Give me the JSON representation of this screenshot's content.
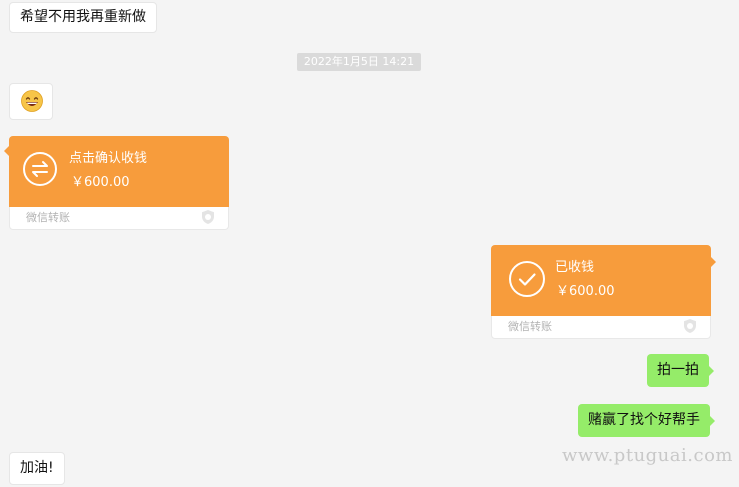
{
  "chat": {
    "messages": {
      "top_text": "希望不用我再重新做",
      "timestamp": "2022年1月5日 14:21",
      "emoji_name": "grinning-face-emoji",
      "transfer_received": {
        "status": "点击确认收钱",
        "amount": "￥600.00",
        "footer": "微信转账"
      },
      "transfer_sent": {
        "status": "已收钱",
        "amount": "￥600.00",
        "footer": "微信转账"
      },
      "reply_pat": "拍一拍",
      "reply_text": "赌赢了找个好帮手",
      "bottom_text": "加油!"
    }
  },
  "watermark": "www.ptuguai.com",
  "colors": {
    "transfer_orange": "#f79c3c",
    "own_bubble_green": "#95ec69",
    "background": "#f4f4f4"
  }
}
